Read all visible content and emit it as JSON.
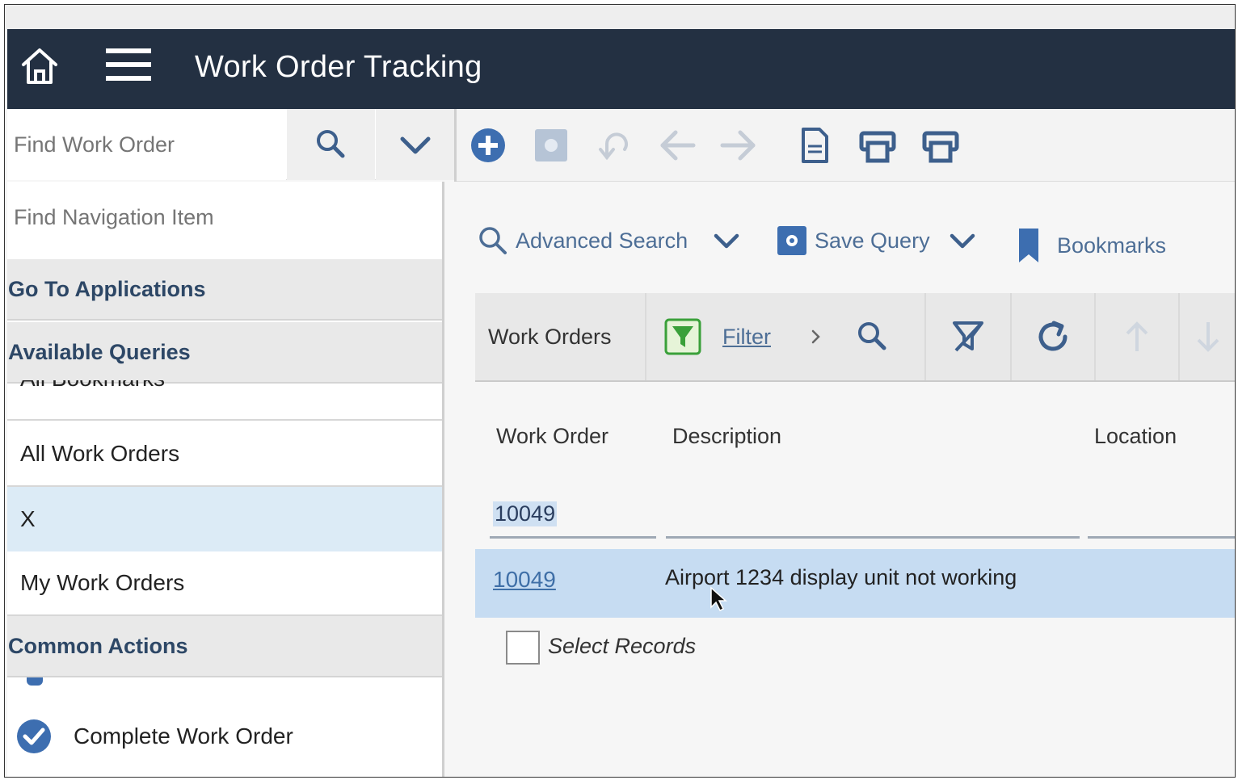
{
  "header": {
    "title": "Work Order Tracking",
    "home_icon": "home-icon",
    "menu_icon": "hamburger-menu-icon"
  },
  "find_bar": {
    "placeholder": "Find Work Order"
  },
  "toolbar": {
    "icons": [
      "add-icon",
      "save-icon",
      "undo-icon",
      "previous-arrow-icon",
      "next-arrow-icon",
      "document-icon",
      "print-icon",
      "print-icon"
    ]
  },
  "left_nav": {
    "find_placeholder": "Find Navigation Item",
    "go_to_applications": "Go To Applications",
    "available_queries": "Available Queries",
    "partial_item": "All Bookmarks",
    "queries": [
      "All Work Orders",
      "X",
      "My Work Orders"
    ],
    "common_actions": "Common Actions",
    "complete_work_order": "Complete Work Order"
  },
  "action_bar": {
    "advanced_search": "Advanced Search",
    "save_query": "Save Query",
    "bookmarks": "Bookmarks"
  },
  "grid": {
    "title": "Work Orders",
    "filter_label": "Filter",
    "columns": [
      "Work Order",
      "Description",
      "Location"
    ],
    "filter_value": "10049",
    "rows": [
      {
        "work_order": "10049",
        "description": "Airport 1234 display unit not working"
      }
    ],
    "select_records": "Select Records"
  },
  "colors": {
    "header_bg": "#233042",
    "accent_blue": "#3d6eb0",
    "selected_row": "#c6dcf2",
    "selected_nav": "#dcebf6",
    "filter_green": "#3aa03a"
  }
}
